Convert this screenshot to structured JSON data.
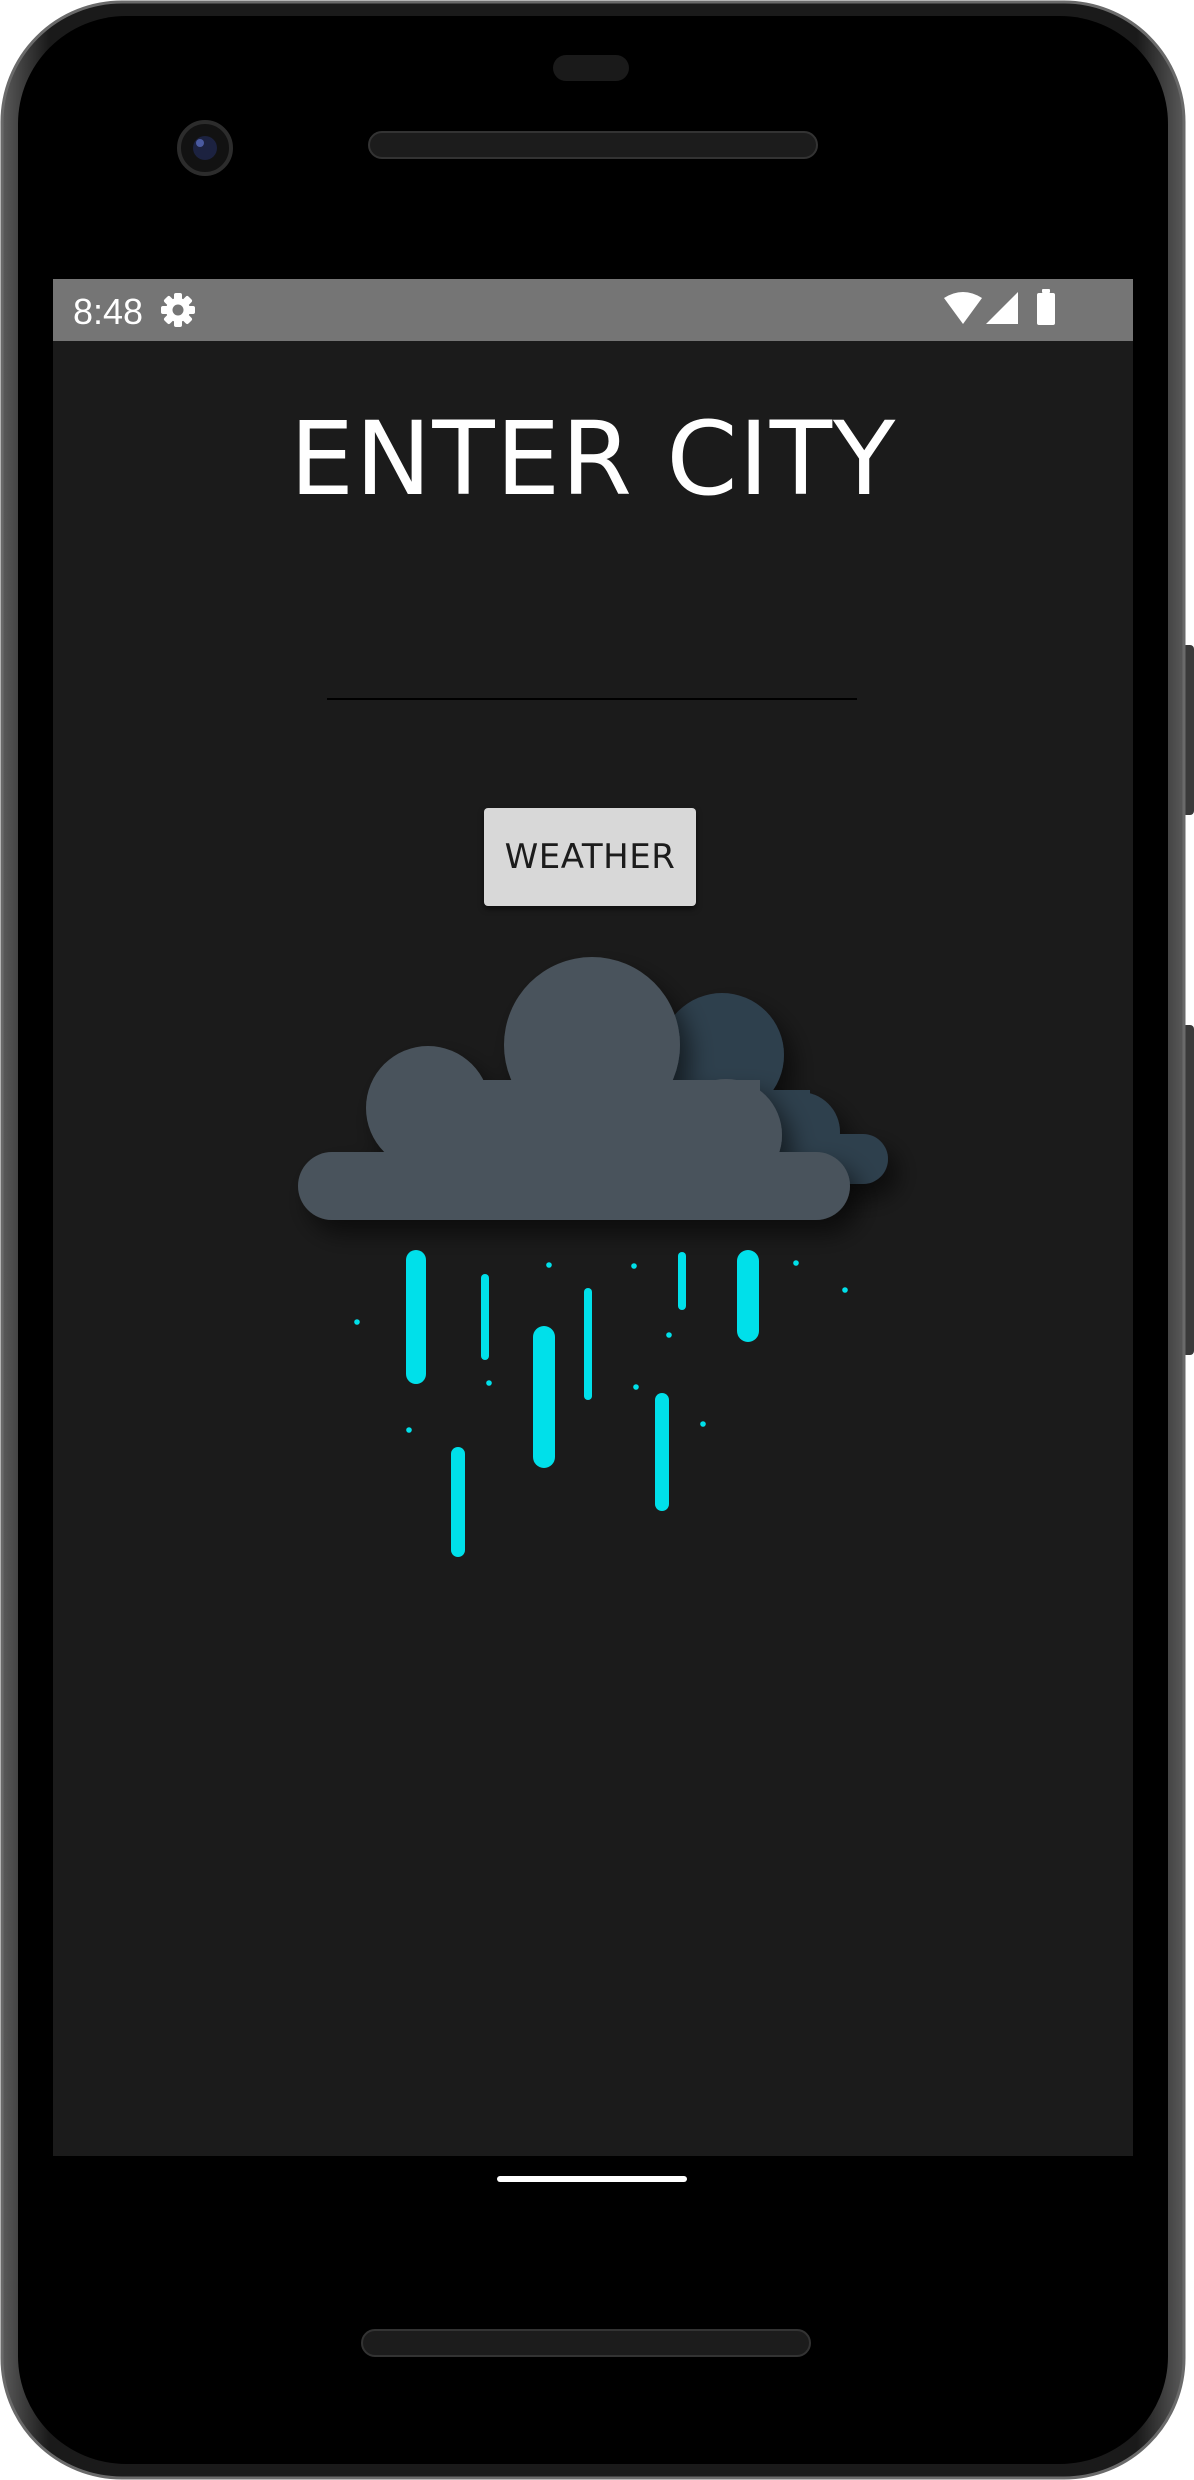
{
  "status_bar": {
    "time": "8:48",
    "icons": [
      "settings-gear-icon",
      "wifi-icon",
      "cellular-signal-icon",
      "battery-icon"
    ]
  },
  "screen": {
    "title": "ENTER CITY",
    "city_input": {
      "value": "",
      "placeholder": ""
    },
    "weather_button_label": "WEATHER",
    "illustration": "rain-cloud-icon"
  },
  "colors": {
    "screen_background": "#1b1b1b",
    "status_bar": "#757575",
    "cloud_front": "#4a535b",
    "cloud_back": "#2f3f4d",
    "rain": "#00e0ea",
    "button": "#d8d8d8"
  }
}
